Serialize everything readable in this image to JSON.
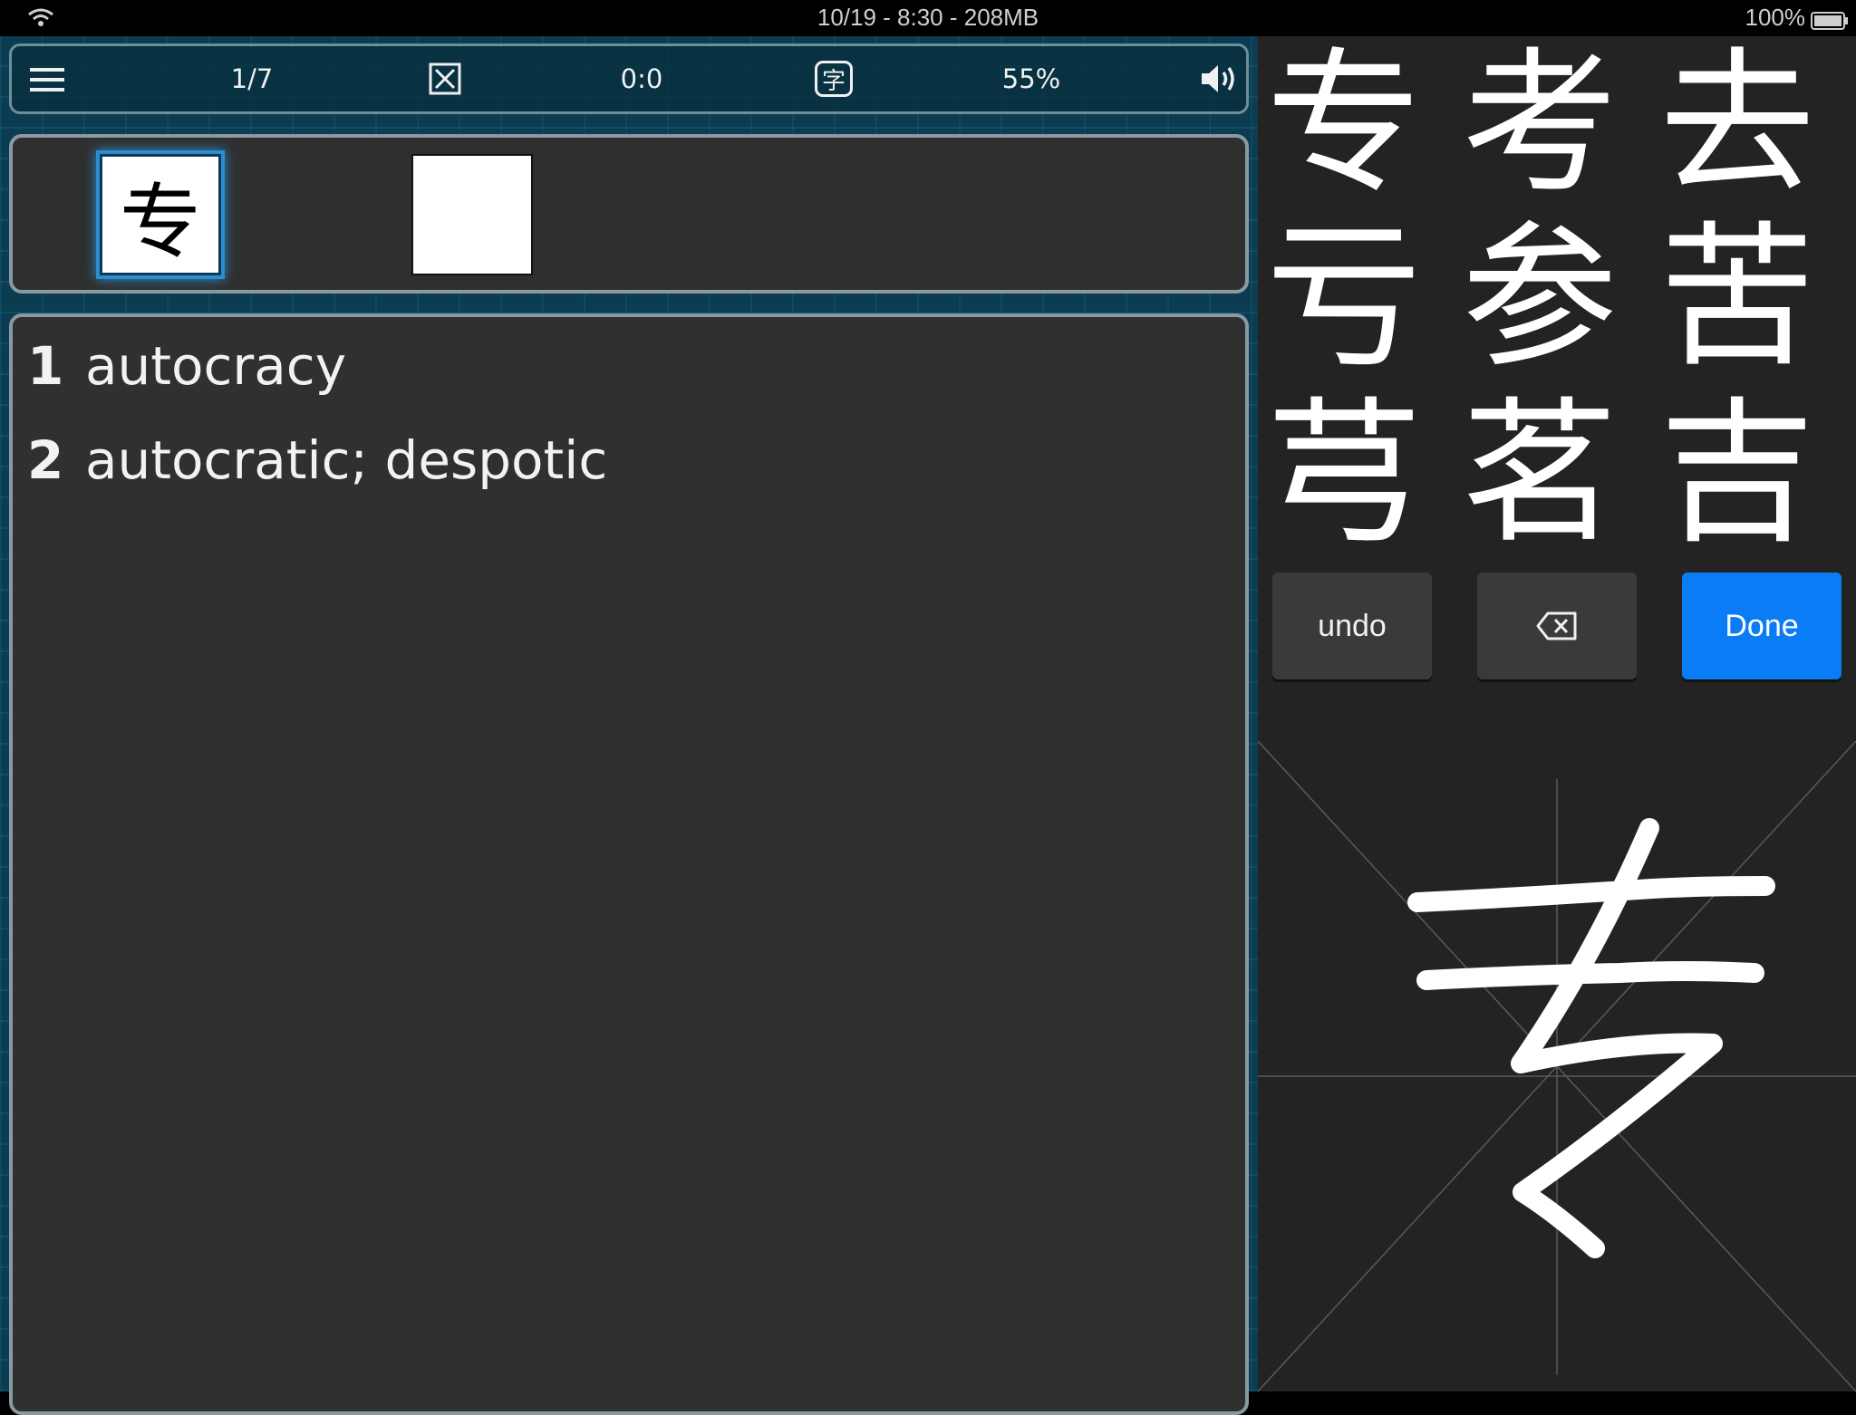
{
  "status_bar": {
    "center_text": "10/19 - 8:30 - 208MB",
    "battery_text": "100%"
  },
  "toolbar": {
    "counter": "1/7",
    "score": "0:0",
    "char_icon_glyph": "字",
    "percent": "55%"
  },
  "characters": {
    "slots": [
      "专",
      ""
    ]
  },
  "definitions": [
    {
      "num": "1",
      "text": "autocracy"
    },
    {
      "num": "2",
      "text": "autocratic; despotic"
    }
  ],
  "candidates": [
    "专",
    "考",
    "去",
    "亏",
    "参",
    "苦",
    "芎",
    "茗",
    "吉"
  ],
  "keys": {
    "undo": "undo",
    "done": "Done"
  },
  "colors": {
    "done_button": "#0a7cf5",
    "selected_glow": "#2a8ed0",
    "panel_bg": "#303030",
    "pattern_bg": "#0b3c52"
  }
}
